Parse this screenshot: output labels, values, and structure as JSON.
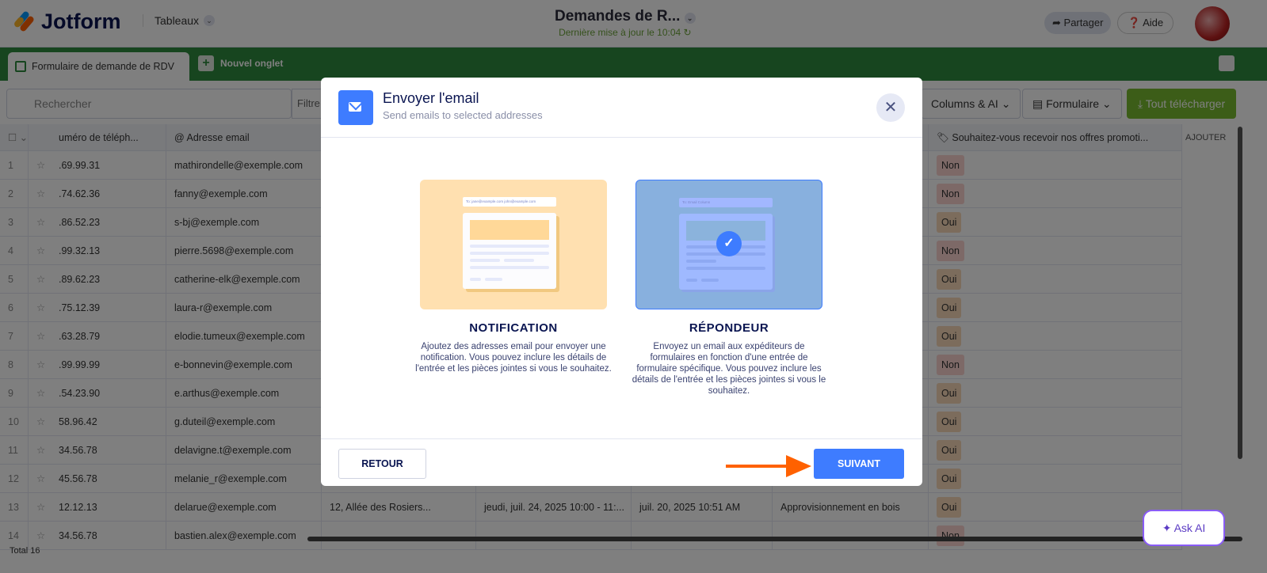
{
  "app": {
    "logo": "Jotform",
    "tables_menu": "Tableaux",
    "title": "Demandes de R...",
    "last_update": "Dernière mise à jour le 10:04",
    "share": "Partager",
    "help": "Aide"
  },
  "tabs": {
    "active": "Formulaire de demande de RDV",
    "new_tab": "Nouvel onglet"
  },
  "toolbar": {
    "search_placeholder": "Rechercher",
    "filter": "Filtre",
    "columns": "Columns & AI",
    "form": "Formulaire",
    "download": "Tout télécharger"
  },
  "table": {
    "headers": {
      "phone": "uméro de téléph...",
      "email": "Adresse email",
      "promo": "Souhaitez-vous recevoir nos offres promoti...",
      "add": "AJOUTER"
    },
    "rows": [
      {
        "n": "1",
        "phone": ".69.99.31",
        "email": "mathirondelle@exemple.com",
        "promo": "Non"
      },
      {
        "n": "2",
        "phone": ".74.62.36",
        "email": "fanny@exemple.com",
        "promo": "Non"
      },
      {
        "n": "3",
        "phone": ".86.52.23",
        "email": "s-bj@exemple.com",
        "promo": "Oui"
      },
      {
        "n": "4",
        "phone": ".99.32.13",
        "email": "pierre.5698@exemple.com",
        "promo": "Non"
      },
      {
        "n": "5",
        "phone": ".89.62.23",
        "email": "catherine-elk@exemple.com",
        "promo": "Oui"
      },
      {
        "n": "6",
        "phone": ".75.12.39",
        "email": "laura-r@exemple.com",
        "promo": "Oui"
      },
      {
        "n": "7",
        "phone": ".63.28.79",
        "email": "elodie.tumeux@exemple.com",
        "promo": "Oui"
      },
      {
        "n": "8",
        "phone": ".99.99.99",
        "email": "e-bonnevin@exemple.com",
        "promo": "Non"
      },
      {
        "n": "9",
        "phone": ".54.23.90",
        "email": "e.arthus@exemple.com",
        "promo": "Oui"
      },
      {
        "n": "10",
        "phone": "58.96.42",
        "email": "g.duteil@exemple.com",
        "promo": "Oui"
      },
      {
        "n": "11",
        "phone": "34.56.78",
        "email": "delavigne.t@exemple.com",
        "promo": "Oui"
      },
      {
        "n": "12",
        "phone": "45.56.78",
        "email": "melanie_r@exemple.com",
        "promo": "Oui"
      },
      {
        "n": "13",
        "phone": "12.12.13",
        "email": "delarue@exemple.com",
        "address": "12, Allée des Rosiers...",
        "date": "jeudi, juil. 24, 2025 10:00 - 11:...",
        "submitted": "juil. 20, 2025 10:51 AM",
        "service": "Approvisionnement en bois",
        "promo": "Oui"
      },
      {
        "n": "14",
        "phone": "34.56.78",
        "email": "bastien.alex@exemple.com",
        "promo": "Non"
      }
    ],
    "total": "Total 16"
  },
  "ask_ai": "Ask AI",
  "modal": {
    "title": "Envoyer l'email",
    "subtitle": "Send emails to selected addresses",
    "options": [
      {
        "title": "NOTIFICATION",
        "description": "Ajoutez des adresses email pour envoyer une notification. Vous pouvez inclure les détails de l'entrée et les pièces jointes si vous le souhaitez.",
        "illustration_to": "To:  jane@example.com   john@example.com"
      },
      {
        "title": "RÉPONDEUR",
        "description": "Envoyez un email aux expéditeurs de formulaires en fonction d'une entrée de formulaire spécifique. Vous pouvez inclure les détails de l'entrée et les pièces jointes si vous le souhaitez.",
        "illustration_to": "To:  Email Column",
        "selected": true
      }
    ],
    "back": "RETOUR",
    "next": "SUIVANT"
  },
  "colors": {
    "accent": "#3e7cff",
    "green": "#2f8a3e",
    "arrow": "#ff6100"
  }
}
